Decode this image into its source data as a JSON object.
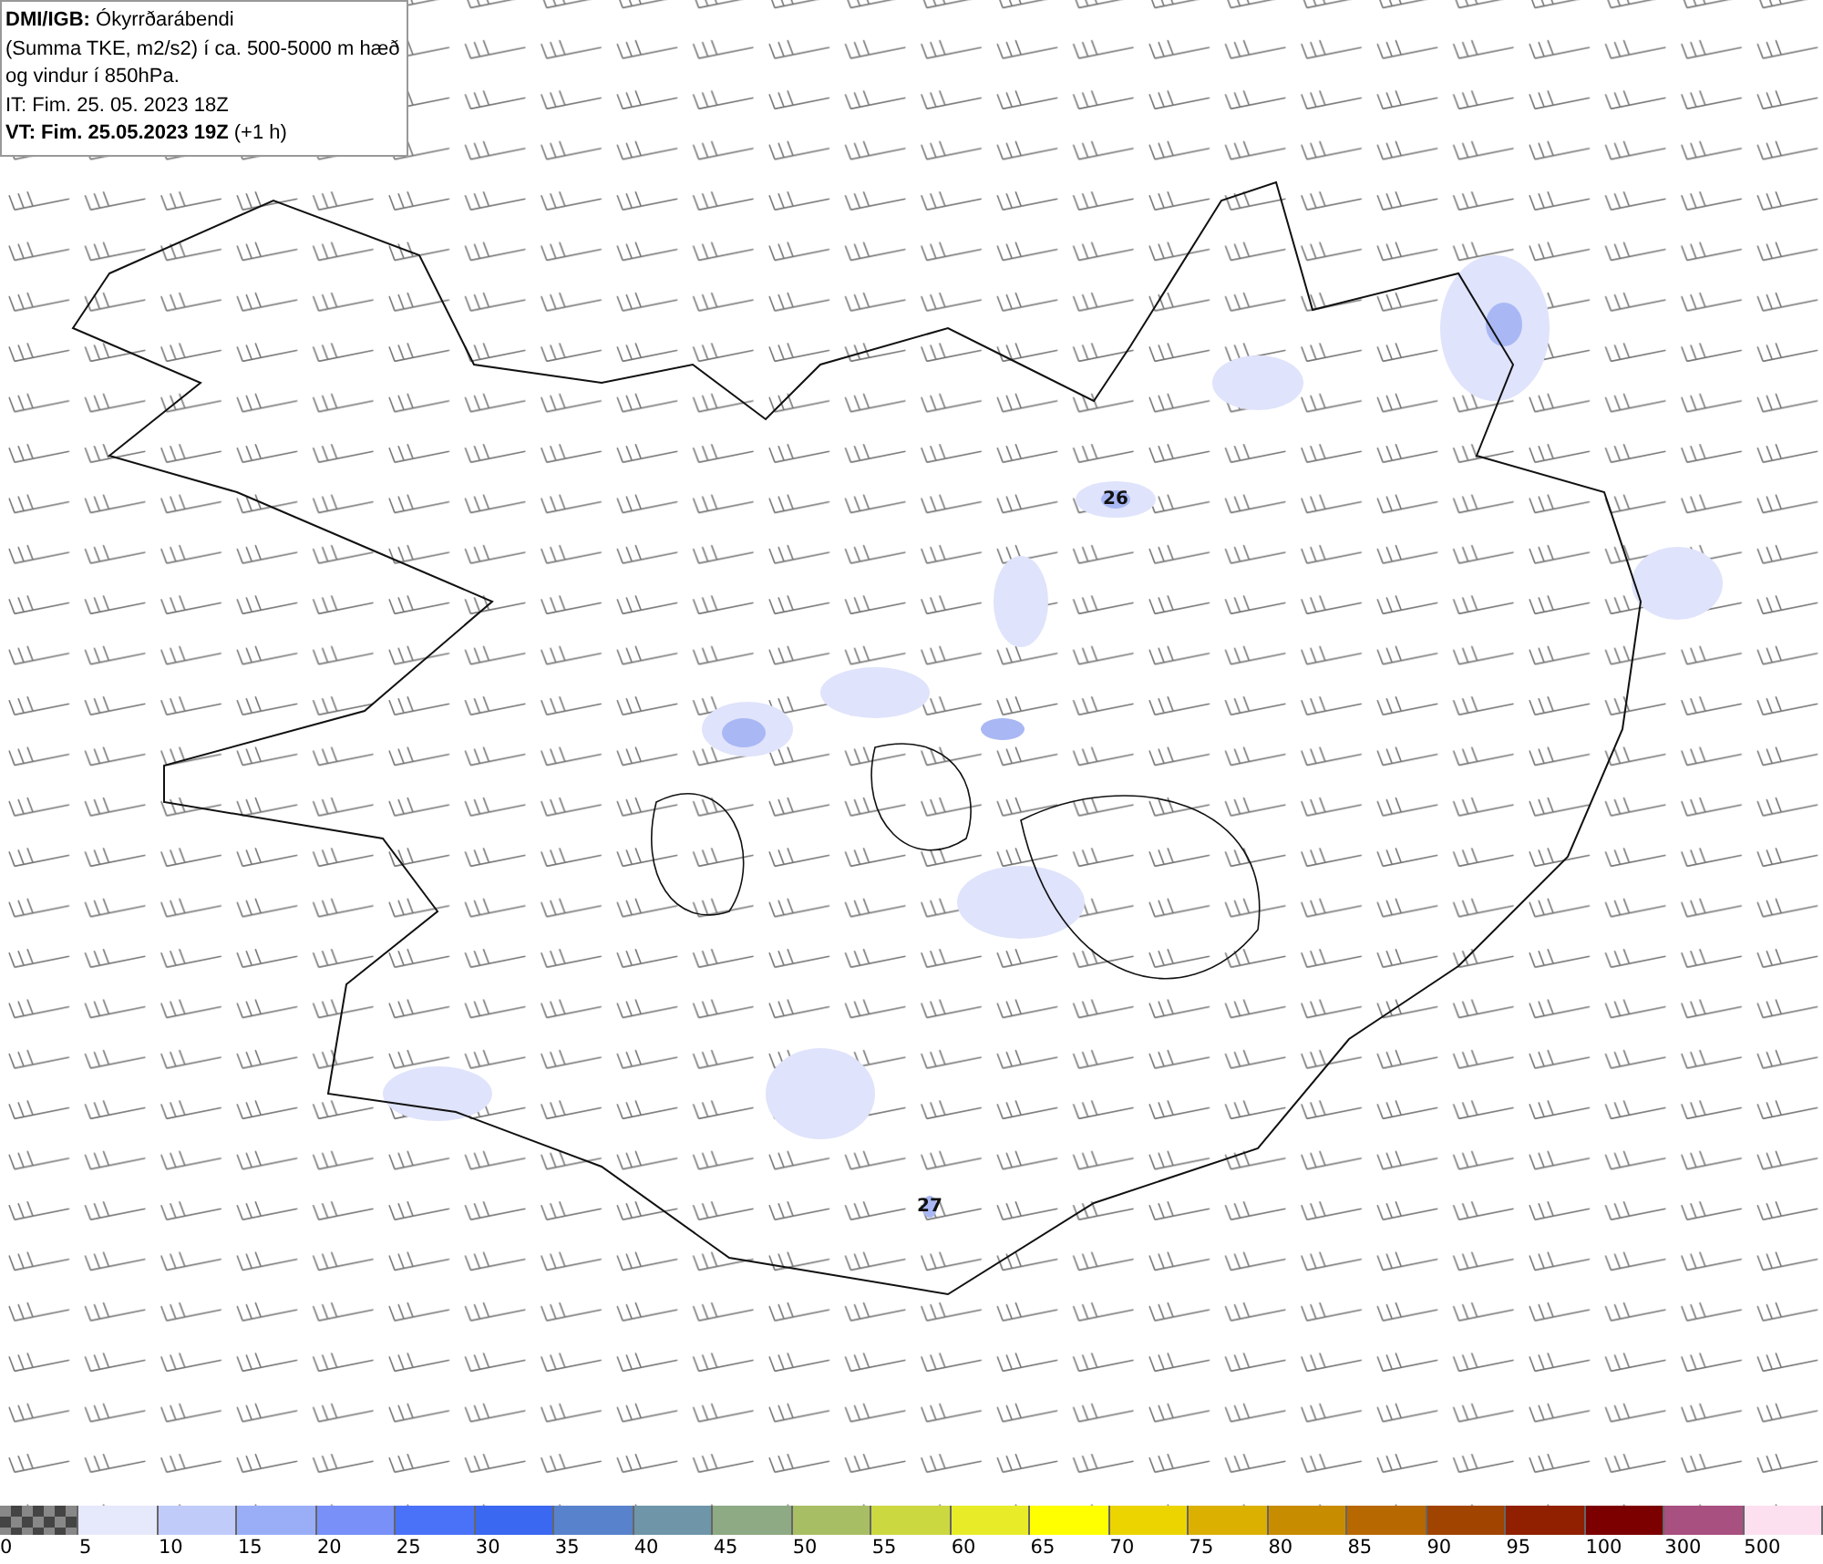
{
  "info_box": {
    "lines": [
      "**DMI/IGB:** Ókyrrðarábendi",
      "(Summa TKE, m2/s2) í ca. 500-5000 m hæð",
      "og vindur í 850hPa.",
      "IT: Fim. 25. 05. 2023 18Z",
      "**VT: Fim. 25.05.2023 19Z** (+1 h)"
    ]
  },
  "map_labels": [
    {
      "text": "26"
    },
    {
      "text": "27"
    }
  ],
  "legend": [
    {
      "label": "0",
      "kind": "checker"
    },
    {
      "label": "5",
      "kind": "solid",
      "color": "#e6e8fc"
    },
    {
      "label": "10",
      "kind": "solid",
      "color": "#c0cbfa"
    },
    {
      "label": "15",
      "kind": "solid",
      "color": "#9aaef8"
    },
    {
      "label": "20",
      "kind": "solid",
      "color": "#7890f8"
    },
    {
      "label": "25",
      "kind": "solid",
      "color": "#4a72f8"
    },
    {
      "label": "30",
      "kind": "solid",
      "color": "#3a68f0"
    },
    {
      "label": "35",
      "kind": "solid",
      "color": "#5882cc"
    },
    {
      "label": "40",
      "kind": "solid",
      "color": "#6e96a8"
    },
    {
      "label": "45",
      "kind": "solid",
      "color": "#8eaa84"
    },
    {
      "label": "50",
      "kind": "solid",
      "color": "#a8be64"
    },
    {
      "label": "55",
      "kind": "solid",
      "color": "#ccd840"
    },
    {
      "label": "60",
      "kind": "solid",
      "color": "#e8ec28"
    },
    {
      "label": "65",
      "kind": "solid",
      "color": "#ffff00"
    },
    {
      "label": "70",
      "kind": "solid",
      "color": "#ecd400"
    },
    {
      "label": "75",
      "kind": "solid",
      "color": "#dcb000"
    },
    {
      "label": "80",
      "kind": "solid",
      "color": "#c88c00"
    },
    {
      "label": "85",
      "kind": "solid",
      "color": "#b86800"
    },
    {
      "label": "90",
      "kind": "solid",
      "color": "#a04400"
    },
    {
      "label": "95",
      "kind": "solid",
      "color": "#902000"
    },
    {
      "label": "100",
      "kind": "solid",
      "color": "#7c0000"
    },
    {
      "label": "300",
      "kind": "solid",
      "color": "#a85080"
    },
    {
      "label": "500",
      "kind": "solid",
      "color": "#fce0f0"
    }
  ]
}
